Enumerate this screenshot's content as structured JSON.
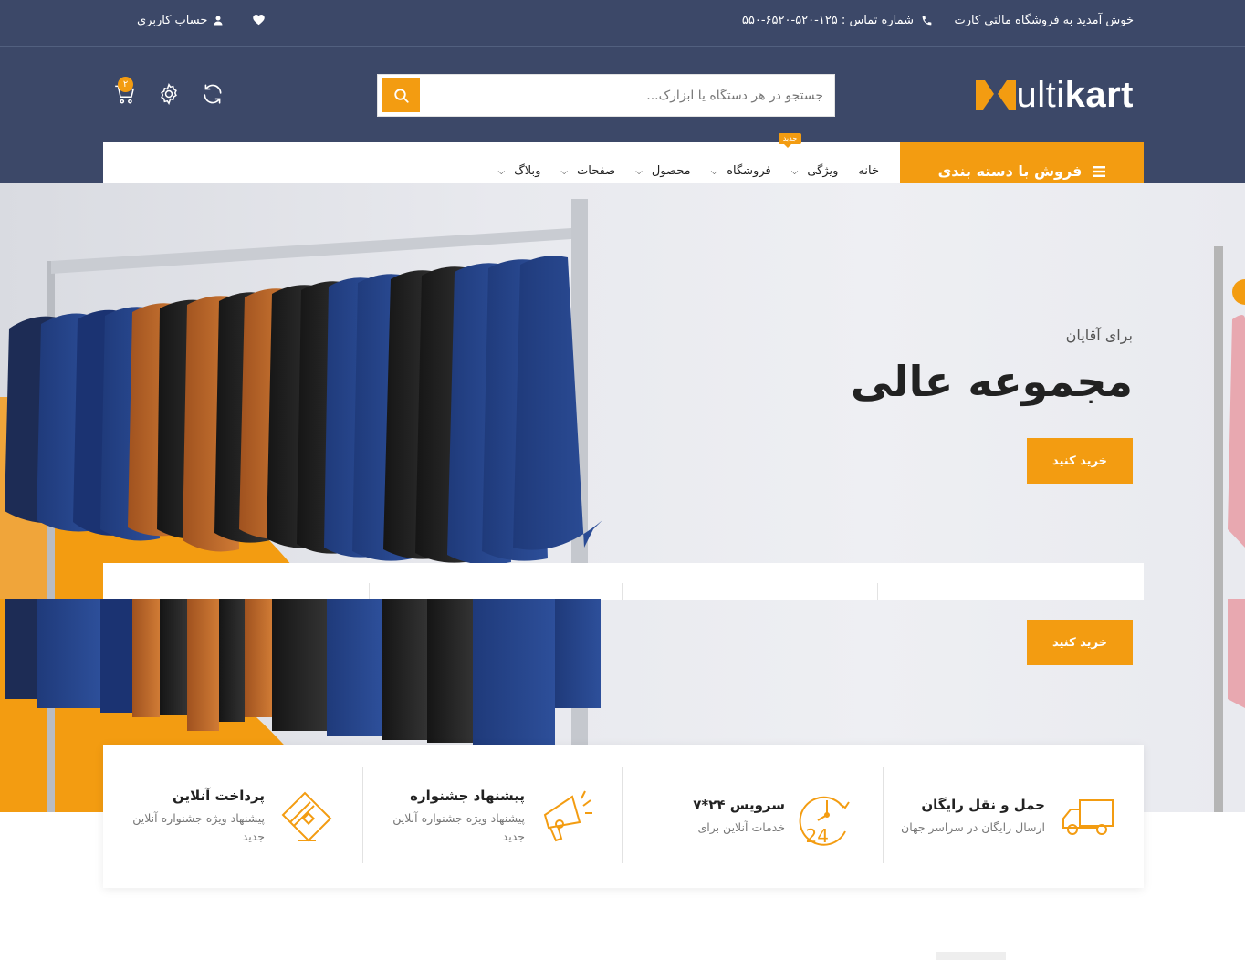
{
  "top_bar": {
    "welcome": "خوش آمدید به فروشگاه مالتی کارت",
    "phone": "شماره تماس : ۱۲۵-۵۲۰-۶۵۲۰-۵۵۰",
    "account": "حساب کاربری",
    "icons": [
      "phone-icon",
      "user-icon",
      "heart-icon"
    ]
  },
  "logo": {
    "first": "ultikart",
    "first_letter": "M"
  },
  "search": {
    "placeholder": "جستجو در هر دستگاه یا ابزارک..."
  },
  "header_icons": {
    "cart_count": "۲",
    "icons": [
      "refresh-icon",
      "settings-icon",
      "cart-icon"
    ]
  },
  "nav": {
    "category_label": "فروش با دسته بندی",
    "new_badge": "جدید",
    "items": [
      {
        "label": "خانه"
      },
      {
        "label": "ویژگی"
      },
      {
        "label": "فروشگاه"
      },
      {
        "label": "محصول"
      },
      {
        "label": "صفحات"
      },
      {
        "label": "وبلاگ"
      }
    ]
  },
  "hero": {
    "subtitle": "برای آقایان",
    "title": "مجموعه عالی",
    "button": "خرید کنید",
    "button2": "خرید کنید"
  },
  "services": [
    {
      "title": "حمل و نقل رایگان",
      "desc": "ارسال رایگان در سراسر جهان",
      "icon": "truck-icon"
    },
    {
      "title": "سرویس ۲۴*۷",
      "desc": "خدمات آنلاین برای",
      "icon": "clock-24-icon"
    },
    {
      "title": "پیشنهاد جشنواره",
      "desc": "پیشنهاد ویژه جشنواره آنلاین جدید",
      "icon": "megaphone-icon"
    },
    {
      "title": "پرداخت آنلاین",
      "desc": "پیشنهاد ویژه جشنواره آنلاین جدید",
      "icon": "card-icon"
    }
  ],
  "colors": {
    "header": "#3c4868",
    "accent": "#f39c11"
  }
}
